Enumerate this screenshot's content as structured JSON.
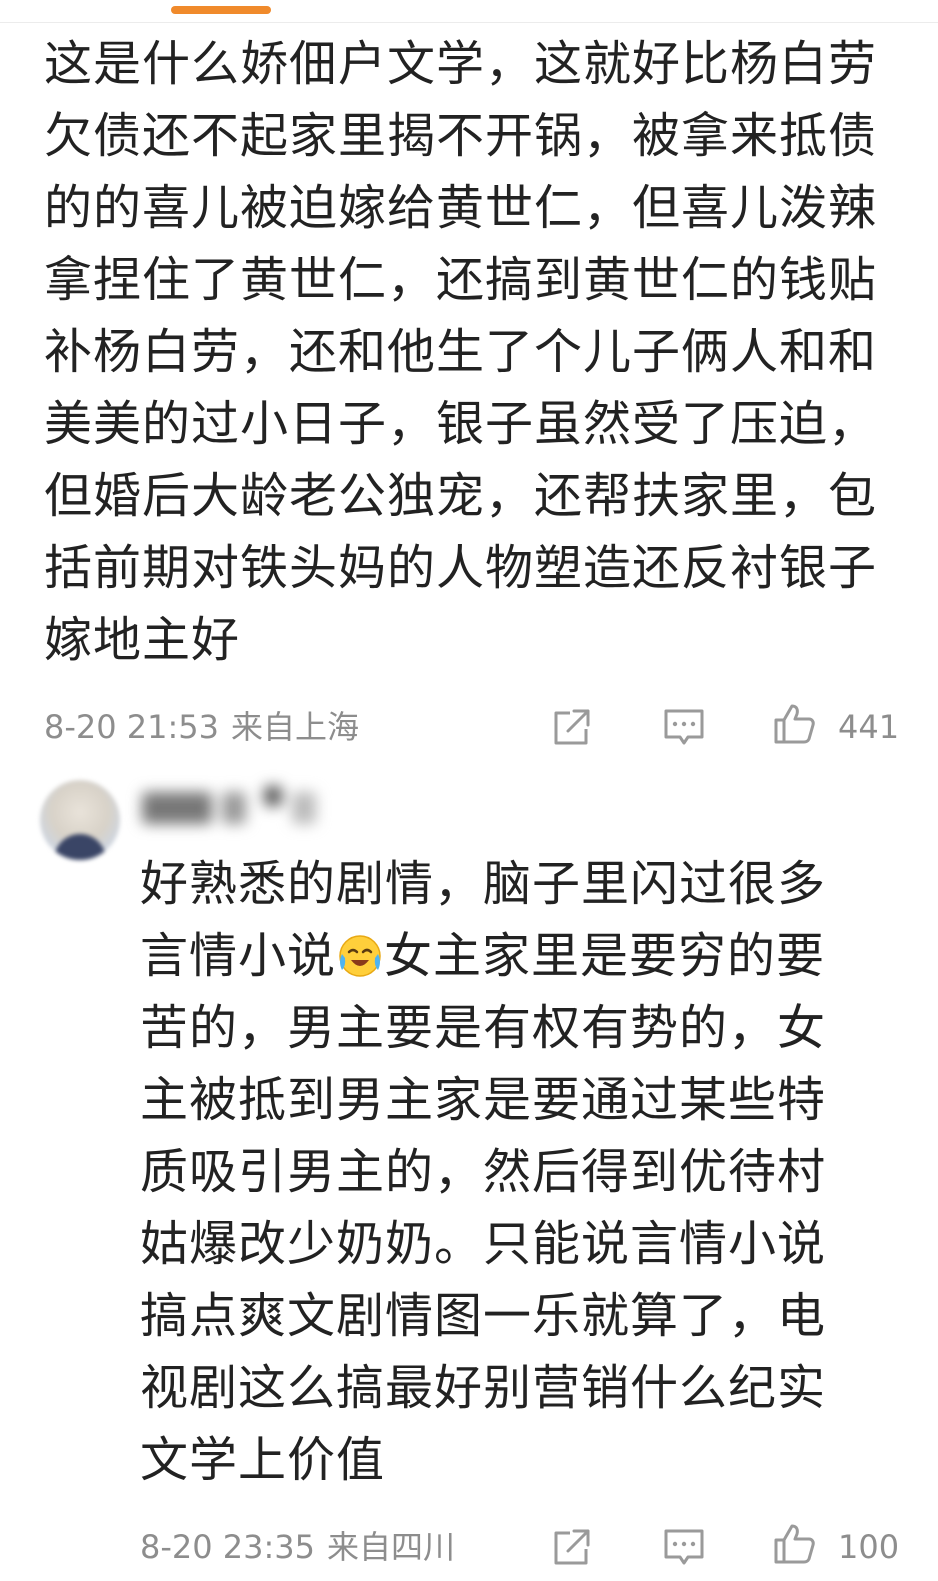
{
  "comments": [
    {
      "text_before_emoji": "这是什么娇佃户文学，这就好比杨白劳欠债还不起家里揭不开锅，被拿来抵债的的喜儿被迫嫁给黄世仁，但喜儿泼辣拿捏住了黄世仁，还搞到黄世仁的钱贴补杨白劳，还和他生了个儿子俩人和和美美的过小日子，银子虽然受了压迫，但婚后大龄老公独宠，还帮扶家里，包括前期对铁头妈的人物塑造还反衬银子嫁地主好",
      "time": "8-20 21:53",
      "location": "来自上海",
      "likes": "441",
      "icons": [
        "share-icon",
        "comment-icon",
        "like-icon"
      ]
    },
    {
      "username_hidden": true,
      "text_before_emoji": "好熟悉的剧情，脑子里闪过很多言情小说",
      "emoji": "crying-laughing-emoji",
      "text_after_emoji": "女主家里是要穷的要苦的，男主要是有权有势的，女主被抵到男主家是要通过某些特质吸引男主的，然后得到优待村姑爆改少奶奶。只能说言情小说搞点爽文剧情图一乐就算了，电视剧这么搞最好别营销什么纪实文学上价值",
      "time": "8-20 23:35",
      "location": "来自四川",
      "likes": "100",
      "icons": [
        "share-icon",
        "comment-icon",
        "like-icon"
      ]
    }
  ],
  "colors": {
    "accent": "#f08a2b",
    "text": "#222222",
    "meta": "#8d8d8d"
  }
}
